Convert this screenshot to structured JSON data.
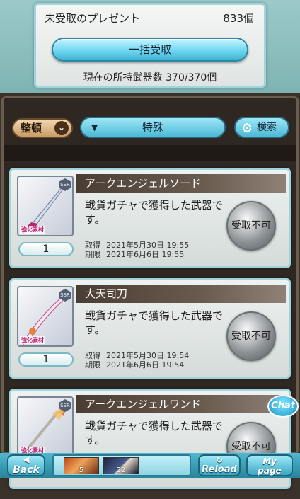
{
  "header": {
    "title": "未受取のプレゼント",
    "count": "833個",
    "claim_all_label": "一括受取",
    "weapon_count": "現在の所持武器数 370/370個"
  },
  "filters": {
    "sort_label": "整頓",
    "sort_icon": "chevron-down-icon",
    "category_label": "特殊",
    "search_label": "検索"
  },
  "items": [
    {
      "name": "アークエンジェルソード",
      "description": "戦貨ガチャで獲得した武器です。",
      "quantity": "1",
      "acquired_label": "取得",
      "acquired": "2021年5月30日 19:55",
      "expires_label": "期限",
      "expires": "2021年6月6日 19:55",
      "status": "受取不可",
      "material_tag": "強化素材",
      "rarity": "SSR"
    },
    {
      "name": "大天司刀",
      "description": "戦貨ガチャで獲得した武器です。",
      "quantity": "1",
      "acquired_label": "取得",
      "acquired": "2021年5月30日 19:54",
      "expires_label": "期限",
      "expires": "2021年6月6日 19:54",
      "status": "受取不可",
      "material_tag": "強化素材",
      "rarity": "SSR"
    },
    {
      "name": "アークエンジェルワンド",
      "description": "戦貨ガチャで獲得した武器です。",
      "status": "受取不可",
      "material_tag": "強化素材",
      "rarity": "SSR"
    }
  ],
  "chat": {
    "label": "Chat"
  },
  "footer": {
    "back_label": "Back",
    "reload_label": "Reload",
    "mypage_label_1": "My",
    "mypage_label_2": "page",
    "tray": [
      {
        "count": "5"
      },
      {
        "count": "22"
      }
    ]
  },
  "colors": {
    "accent": "#4cb9d6",
    "panel_bg": "#2f2822",
    "name_bar": "#4a3d33"
  }
}
